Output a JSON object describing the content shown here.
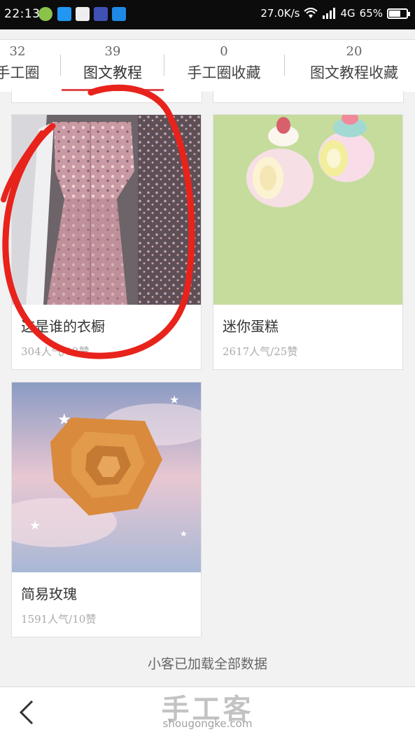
{
  "status_bar": {
    "time": "22:13",
    "net_speed": "27.0K/s",
    "network": "4G",
    "battery": "65%",
    "battery_level": 0.65
  },
  "tabs": [
    {
      "count": "32",
      "label": "手工圈"
    },
    {
      "count": "39",
      "label": "图文教程"
    },
    {
      "count": "0",
      "label": "手工圈收藏"
    },
    {
      "count": "20",
      "label": "图文教程收藏"
    }
  ],
  "cards": [
    {
      "title": "这是谁的衣橱",
      "meta": "304人气/12赞"
    },
    {
      "title": "迷你蛋糕",
      "meta": "2617人气/25赞"
    },
    {
      "title": "简易玫瑰",
      "meta": "1591人气/10赞"
    }
  ],
  "footer": {
    "loaded_text": "小客已加载全部数据",
    "watermark": "手工客",
    "watermark_url": "shougongke.com"
  },
  "colors": {
    "accent": "#e0474c",
    "annotation": "#e8231c"
  },
  "icons": [
    "back-arrow-icon",
    "wifi-icon",
    "signal-icon",
    "battery-icon"
  ]
}
